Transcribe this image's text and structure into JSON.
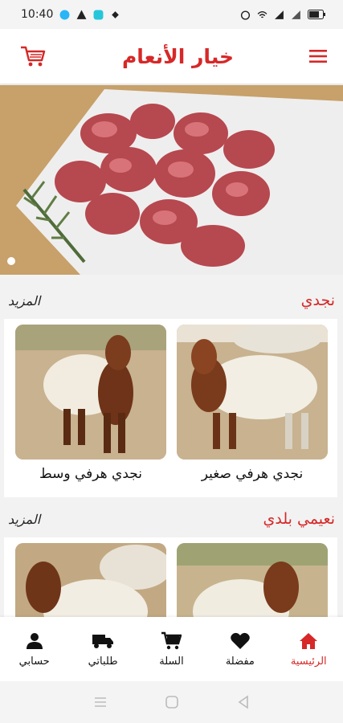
{
  "status_bar": {
    "time": "10:40",
    "battery_icon": "battery-icon"
  },
  "app_bar": {
    "title": "خيار الأنعام",
    "cart_icon": "cart-icon",
    "menu_icon": "menu-icon"
  },
  "colors": {
    "accent": "#d62828",
    "background": "#f2f2f2"
  },
  "sections": [
    {
      "title": "نجدي",
      "more": "المزيد",
      "items": [
        {
          "label": "نجدي هرفي صغير"
        },
        {
          "label": "نجدي هرفي وسط"
        }
      ]
    },
    {
      "title": "نعيمي بلدي",
      "more": "المزيد",
      "items": []
    }
  ],
  "bottom_nav": [
    {
      "label": "الرئيسية",
      "icon": "home-icon",
      "active": true
    },
    {
      "label": "مفضلة",
      "icon": "heart-icon",
      "active": false
    },
    {
      "label": "السلة",
      "icon": "cart-icon",
      "active": false
    },
    {
      "label": "طلباتي",
      "icon": "truck-icon",
      "active": false
    },
    {
      "label": "حسابي",
      "icon": "user-icon",
      "active": false
    }
  ]
}
